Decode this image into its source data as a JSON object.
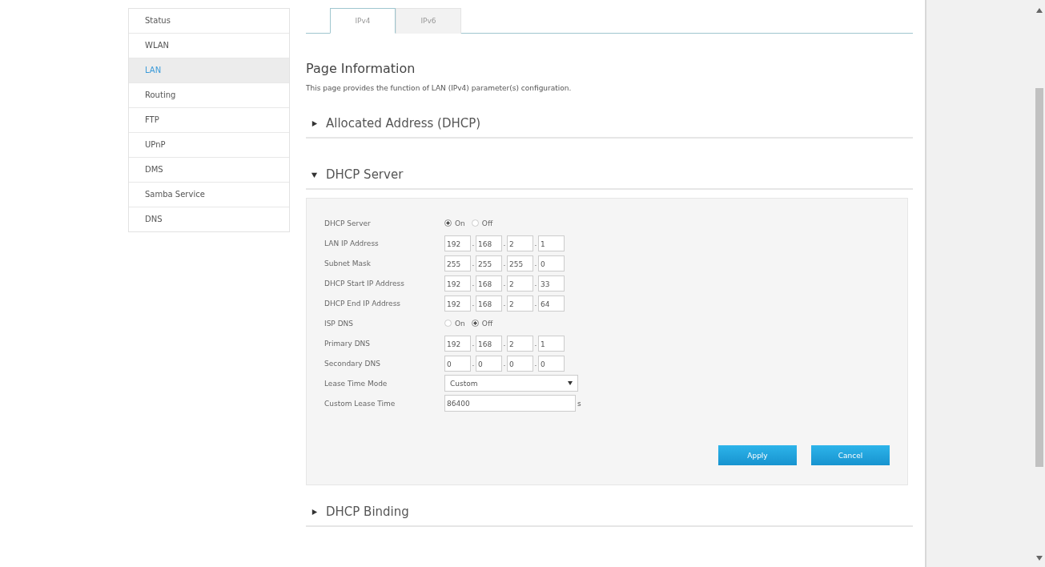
{
  "sidebar": {
    "items": [
      {
        "label": "Status",
        "selected": false
      },
      {
        "label": "WLAN",
        "selected": false
      },
      {
        "label": "LAN",
        "selected": true
      },
      {
        "label": "Routing",
        "selected": false
      },
      {
        "label": "FTP",
        "selected": false
      },
      {
        "label": "UPnP",
        "selected": false
      },
      {
        "label": "DMS",
        "selected": false
      },
      {
        "label": "Samba Service",
        "selected": false
      },
      {
        "label": "DNS",
        "selected": false
      }
    ]
  },
  "tabs": [
    {
      "label": "IPv4",
      "selected": true
    },
    {
      "label": "IPv6",
      "selected": false
    }
  ],
  "page_info": {
    "title": "Page Information",
    "description": "This page provides the function of LAN (IPv4) parameter(s) configuration."
  },
  "sections": [
    {
      "title": "Allocated Address (DHCP)",
      "expanded": false
    },
    {
      "title": "DHCP Server",
      "expanded": true,
      "form": {
        "rows": [
          {
            "kind": "radio",
            "label": "DHCP Server",
            "options": [
              {
                "label": "On",
                "selected": true
              },
              {
                "label": "Off",
                "selected": false
              }
            ]
          },
          {
            "kind": "ip",
            "label": "LAN IP Address",
            "octets": [
              "192",
              "168",
              "2",
              "1"
            ],
            "separators": [
              ".",
              ".",
              "."
            ]
          },
          {
            "kind": "ip",
            "label": "Subnet Mask",
            "octets": [
              "255",
              "255",
              "255",
              "0"
            ],
            "separators": [
              ".",
              ".",
              "."
            ]
          },
          {
            "kind": "ip",
            "label": "DHCP Start IP Address",
            "octets": [
              "192",
              "168",
              "2",
              "33"
            ],
            "separators": [
              ".",
              ".",
              "."
            ]
          },
          {
            "kind": "ip",
            "label": "DHCP End IP Address",
            "octets": [
              "192",
              "168",
              "2",
              "64"
            ],
            "separators": [
              ".",
              ".",
              "."
            ]
          },
          {
            "kind": "radio",
            "label": "ISP DNS",
            "options": [
              {
                "label": "On",
                "selected": false
              },
              {
                "label": "Off",
                "selected": true
              }
            ]
          },
          {
            "kind": "ip",
            "label": "Primary DNS",
            "octets": [
              "192",
              "168",
              "2",
              "1"
            ],
            "separators": [
              ".",
              ".",
              "."
            ]
          },
          {
            "kind": "ip",
            "label": "Secondary DNS",
            "octets": [
              "0",
              "0",
              "0",
              "0"
            ],
            "separators": [
              ".",
              ".",
              "."
            ]
          },
          {
            "kind": "select",
            "label": "Lease Time Mode",
            "value": "Custom"
          },
          {
            "kind": "number",
            "label": "Custom Lease Time",
            "value": "86400",
            "unit": "s"
          }
        ],
        "buttons": [
          "Apply",
          "Cancel"
        ]
      }
    },
    {
      "title": "DHCP Binding",
      "expanded": false
    }
  ]
}
